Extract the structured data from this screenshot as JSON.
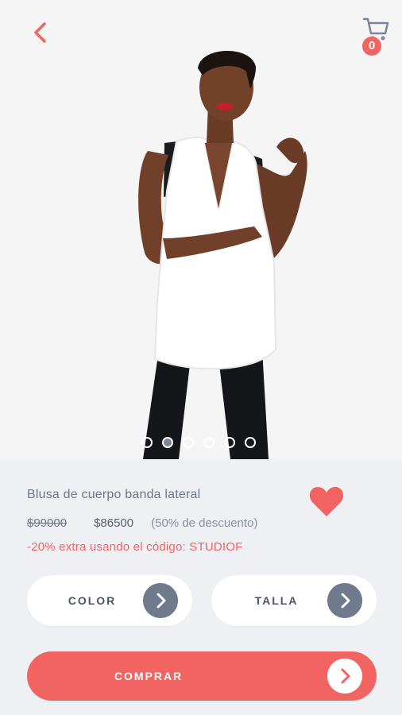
{
  "header": {
    "back_icon": "chevron-left-icon",
    "cart_icon": "shopping-cart-icon",
    "cart_count": "0"
  },
  "gallery": {
    "image_count": 6,
    "active_index": 1
  },
  "product": {
    "name": "Blusa de cuerpo banda lateral",
    "old_price": "$99000",
    "new_price": "$86500",
    "discount": "(50% de descuento)",
    "promo": "-20% extra usando el código: STUDIOF",
    "favorite_icon": "heart-icon"
  },
  "options": {
    "color_label": "COLOR",
    "size_label": "TALLA"
  },
  "actions": {
    "buy_label": "COMPRAR"
  },
  "colors": {
    "accent": "#f16462",
    "arrow_gray": "#6f7b8c",
    "background": "#eef0f4"
  }
}
